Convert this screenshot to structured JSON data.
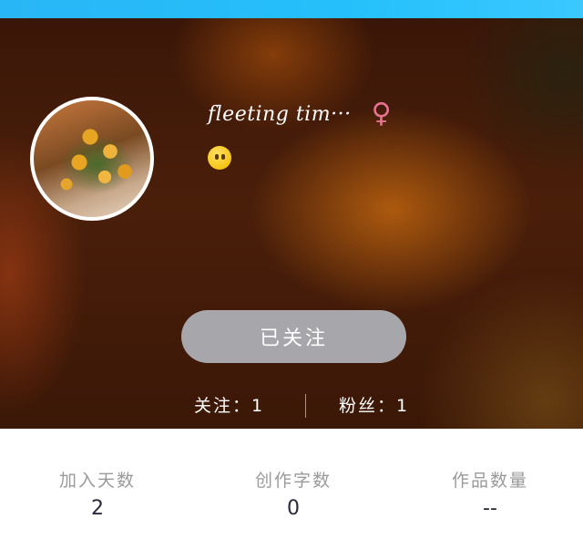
{
  "colors": {
    "top_bar": "#29b6f6",
    "follow_button_bg": "#a7a6ab",
    "gender_icon": "#e8718f"
  },
  "profile": {
    "username": "fleeting tim···",
    "gender_icon": "female-symbol-icon",
    "gender_symbol": "♀",
    "status_emoji": "face-without-mouth-emoji"
  },
  "follow_button": {
    "label": "已关注"
  },
  "stats": {
    "following": "关注：1",
    "followers": "粉丝：1"
  },
  "info": [
    {
      "label": "加入天数",
      "value": "2"
    },
    {
      "label": "创作字数",
      "value": "0"
    },
    {
      "label": "作品数量",
      "value": "--"
    }
  ]
}
